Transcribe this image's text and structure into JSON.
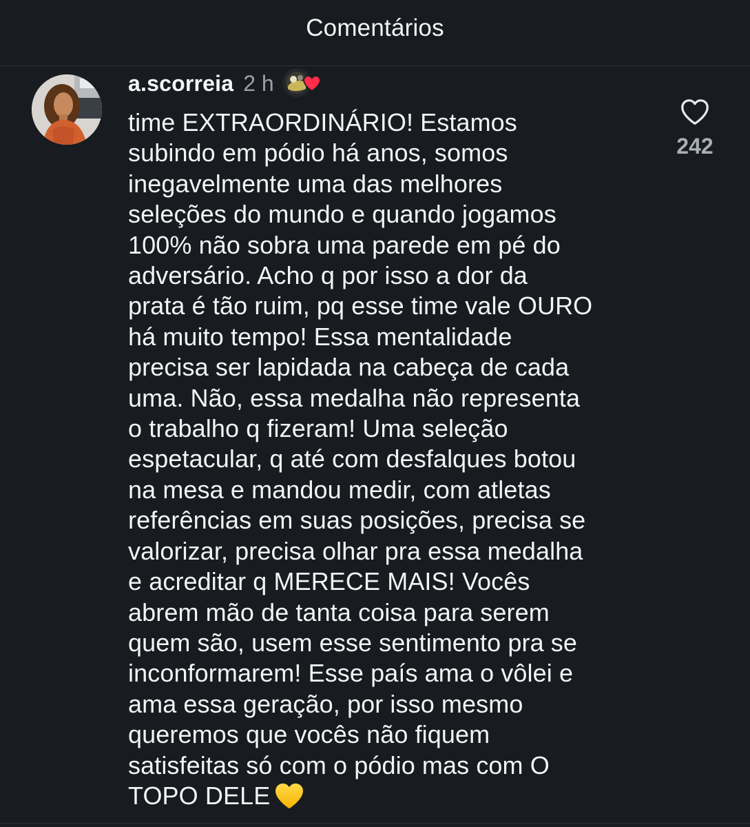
{
  "header": {
    "title": "Comentários"
  },
  "comment": {
    "username": "a.scorreia",
    "time": "2 h",
    "text": "time EXTRAORDINÁRIO! Estamos\nsubindo em pódio há anos, somos\ninegavelmente uma das melhores\nseleções do mundo e quando jogamos\n100% não sobra uma parede em pé do\nadversário. Acho q por isso a dor da\nprata é tão ruim, pq esse time vale OURO\nhá muito tempo! Essa mentalidade\nprecisa ser lapidada na cabeça de cada\numa. Não, essa medalha não representa\no trabalho q fizeram! Uma seleção\nespetacular, q até com desfalques botou\nna mesa e mandou medir, com atletas\nreferências em suas posições, precisa se\nvalorizar, precisa olhar pra essa medalha\ne acreditar q MERECE MAIS! Vocês\nabrem mão de tanta coisa para serem\nquem são, usem esse sentimento pra se\ninconformarem! Esse país ama o vôlei e\nama essa geração, por isso mesmo\nqueremos que vocês não fiquem\nsatisfeitas só com o pódio mas com O\nTOPO DELE",
    "trailing_emoji": "yellow-heart-emoji",
    "like_count": "242",
    "like_icon": "heart-outline-icon",
    "creator_liked_badge_icon": "red-heart-icon"
  },
  "colors": {
    "background": "#181b1f",
    "text": "#f2f4f5",
    "muted": "#9aa1a8",
    "divider": "#2f3338",
    "red_heart": "#ff2d4a",
    "yellow_heart": "#ffcc22"
  }
}
